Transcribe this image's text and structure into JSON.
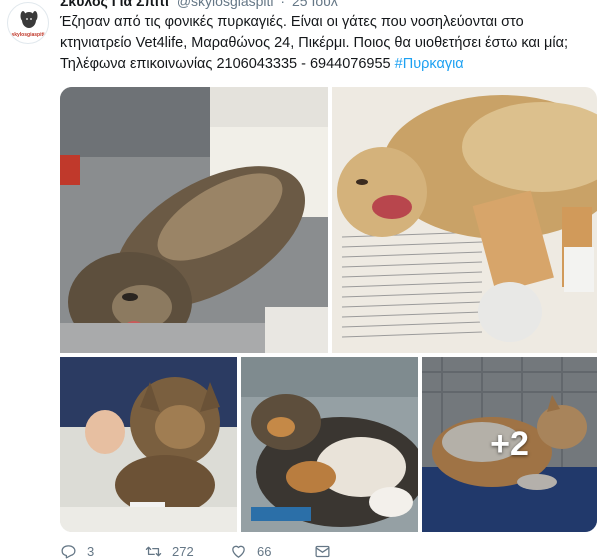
{
  "author": {
    "name": "Σκύλος Για Σπίτι",
    "handle": "@skylosgiaspiti",
    "separator": "·",
    "time": "25 Ιουλ",
    "avatar_text": "skylosgiaspiti"
  },
  "tweet": {
    "text": "Έζησαν από τις φονικές πυρκαγιές. Είναι οι γάτες που νοσηλεύονται στο κτηνιατρείο Vet4life, Μαραθώνος 24, Πικέρμι. Ποιος θα υιοθετήσει έστω και μία; Τηλέφωνα επικοινωνίας 2106043335 - 6944076955",
    "hashtag": "#Πυρκαγια"
  },
  "media": {
    "more_label": "+2"
  },
  "actions": {
    "replies": "3",
    "retweets": "272",
    "likes": "66"
  },
  "colors": {
    "link": "#1da1f2",
    "text": "#14171a",
    "muted": "#657786"
  },
  "icons": [
    "reply-icon",
    "retweet-icon",
    "like-icon",
    "message-icon"
  ]
}
